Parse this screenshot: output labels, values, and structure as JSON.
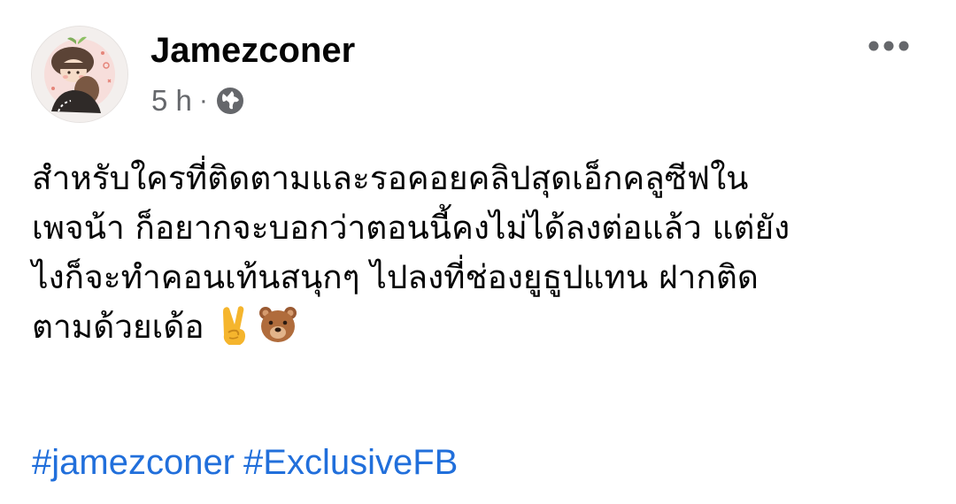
{
  "post": {
    "author": {
      "name": "Jamezconer",
      "avatar_icon": "profile-avatar"
    },
    "meta": {
      "time": "5 h",
      "separator": "·",
      "audience_icon": "globe-icon"
    },
    "menu_icon": "more-options-icon",
    "text_lines": [
      "สำหรับใครที่ติดตามและรอคอยคลิปสุดเอ็กคลูซีฟใน",
      "เพจน้า ก็อยากจะบอกว่าตอนนี้คงไม่ได้ลงต่อแล้ว  แต่ยัง",
      "ไงก็จะทำคอนเท้นสนุกๆ ไปลงที่ช่องยูธูปแทน ฝากติด",
      "ตามด้วยเด้อ"
    ],
    "emojis": [
      "victory-hand-emoji",
      "bear-face-emoji"
    ],
    "hashtags": [
      "#jamezconer",
      "#ExclusiveFB"
    ]
  },
  "colors": {
    "text_primary": "#050505",
    "text_secondary": "#65676b",
    "hashtag": "#216fdb",
    "background": "#ffffff"
  }
}
